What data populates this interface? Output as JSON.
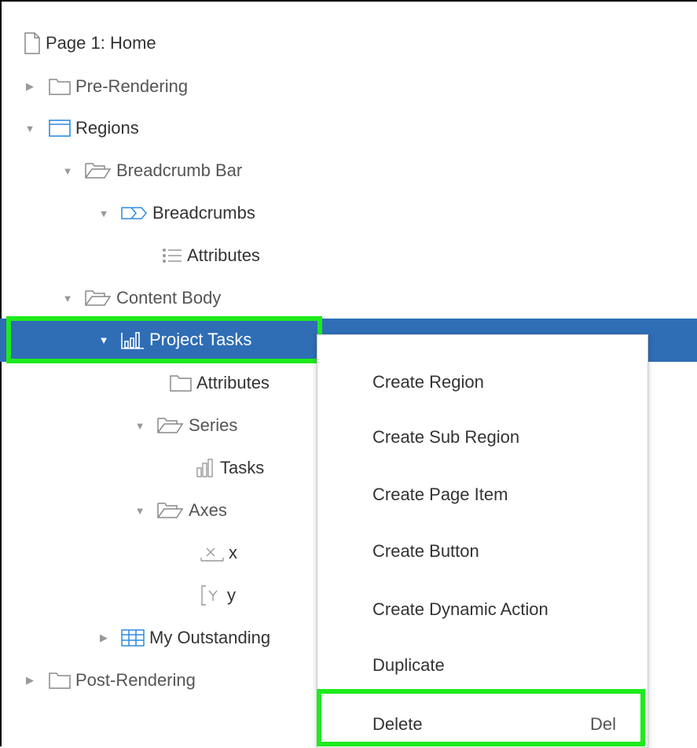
{
  "tree": {
    "page": "Page 1: Home",
    "pre_rendering": "Pre-Rendering",
    "regions": "Regions",
    "breadcrumb_bar": "Breadcrumb Bar",
    "breadcrumbs": "Breadcrumbs",
    "attributes_1": "Attributes",
    "content_body": "Content Body",
    "project_tasks": "Project Tasks",
    "attributes_2": "Attributes",
    "series": "Series",
    "tasks": "Tasks",
    "axes": "Axes",
    "axis_x": "x",
    "axis_y": "y",
    "my_outstanding": "My Outstanding",
    "post_rendering": "Post-Rendering"
  },
  "context_menu": {
    "create_region": "Create Region",
    "create_sub_region": "Create Sub Region",
    "create_page_item": "Create Page Item",
    "create_button": "Create Button",
    "create_dynamic_action": "Create Dynamic Action",
    "duplicate": "Duplicate",
    "delete": "Delete",
    "delete_shortcut": "Del"
  },
  "colors": {
    "selection": "#2f6db5",
    "highlight": "#1eea1e",
    "icon_blue": "#2e8be0",
    "icon_gray": "#888888"
  }
}
